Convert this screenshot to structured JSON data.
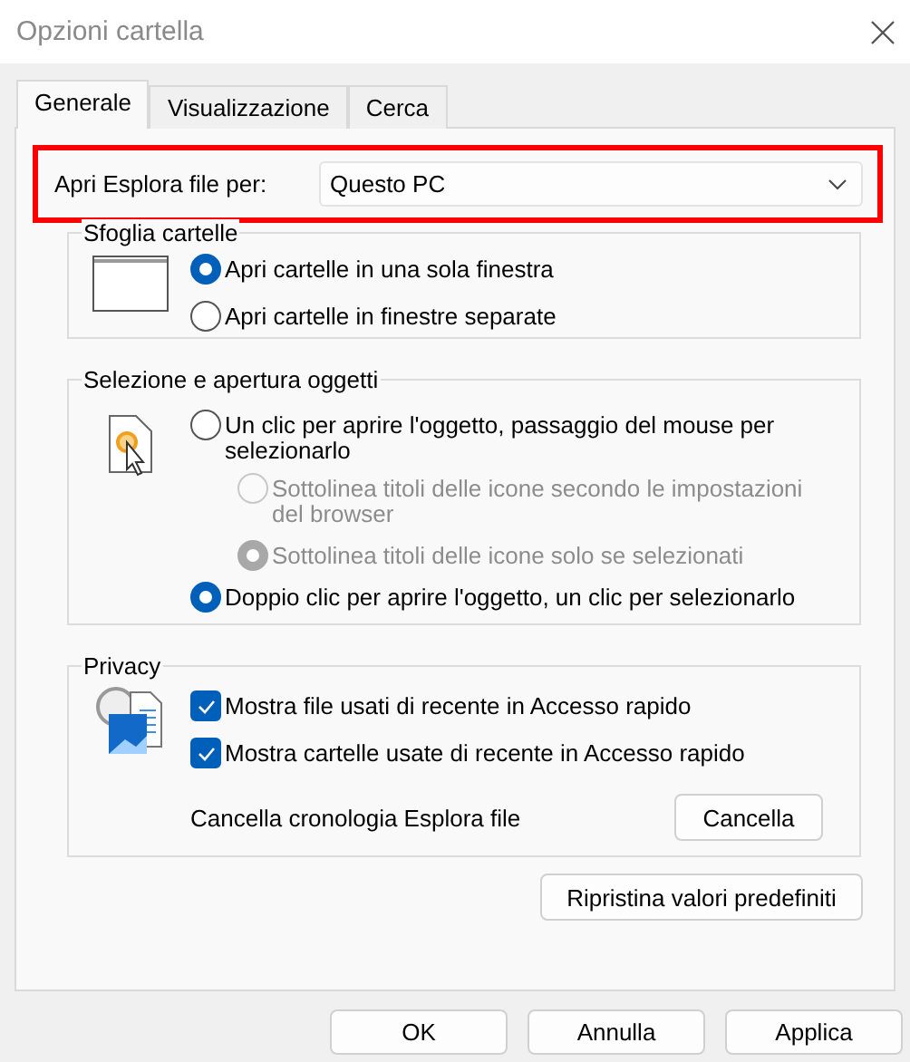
{
  "window": {
    "title": "Opzioni cartella"
  },
  "tabs": [
    {
      "label": "Generale",
      "selected": true
    },
    {
      "label": "Visualizzazione",
      "selected": false
    },
    {
      "label": "Cerca",
      "selected": false
    }
  ],
  "open_explorer": {
    "label": "Apri Esplora file per:",
    "value": "Questo PC",
    "highlighted": true
  },
  "browse_group": {
    "title": "Sfoglia cartelle",
    "options": [
      {
        "label": "Apri cartelle in una sola finestra",
        "selected": true,
        "disabled": false
      },
      {
        "label": "Apri cartelle in finestre separate",
        "selected": false,
        "disabled": false
      }
    ]
  },
  "click_group": {
    "title": "Selezione e apertura oggetti",
    "options": [
      {
        "label": "Un clic per aprire l'oggetto, passaggio del mouse per selezionarlo",
        "selected": false,
        "disabled": false,
        "children": [
          {
            "label": "Sottolinea titoli delle icone secondo le impostazioni del browser",
            "selected": false,
            "disabled": true
          },
          {
            "label": "Sottolinea titoli delle icone solo se selezionati",
            "selected": true,
            "disabled": true
          }
        ]
      },
      {
        "label": "Doppio clic per aprire l'oggetto, un clic per selezionarlo",
        "selected": true,
        "disabled": false
      }
    ]
  },
  "privacy": {
    "title": "Privacy",
    "checkboxes": [
      {
        "label": "Mostra file usati di recente in Accesso rapido",
        "checked": true
      },
      {
        "label": "Mostra cartelle usate di recente in Accesso rapido",
        "checked": true
      }
    ],
    "clear_label": "Cancella cronologia Esplora file",
    "clear_button": "Cancella"
  },
  "restore_button": "Ripristina valori predefiniti",
  "buttons": [
    "OK",
    "Annulla",
    "Applica"
  ]
}
